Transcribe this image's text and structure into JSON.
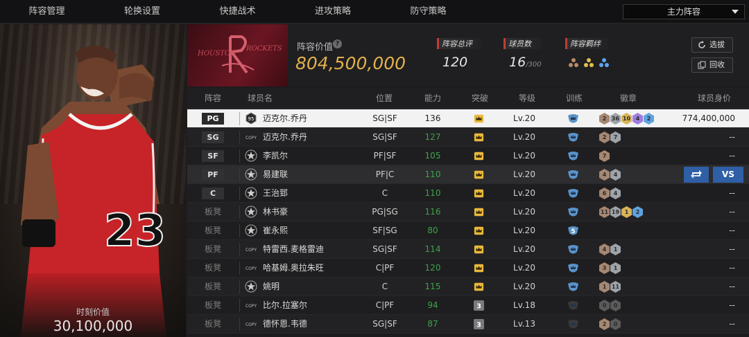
{
  "tabs": [
    {
      "label": "阵容管理",
      "active": true
    },
    {
      "label": "轮换设置",
      "active": false
    },
    {
      "label": "快捷战术",
      "active": false
    },
    {
      "label": "进攻策略",
      "active": false
    },
    {
      "label": "防守策略",
      "active": false
    }
  ],
  "lineup_select": {
    "value": "主力阵容"
  },
  "portrait": {
    "moment_label": "时刻价值",
    "moment_value": "30,100,000",
    "jersey_number": "23"
  },
  "team": {
    "logo_text_left": "HOUSTON",
    "logo_text_right": "ROCKETS",
    "value_label": "阵容价值",
    "value_amount": "804,500,000",
    "rating_label": "阵容总评",
    "rating_value": "120",
    "count_label": "球员数",
    "count_value": "16",
    "count_max": "/300",
    "bond_label": "阵容羁绊",
    "pick_label": "选拔",
    "recall_label": "回收"
  },
  "columns": {
    "lineup": "阵容",
    "name": "球员名",
    "position": "位置",
    "ability": "能力",
    "breakthrough": "突破",
    "level": "等级",
    "training": "训练",
    "badges": "徽章",
    "value": "球员身价"
  },
  "actions": {
    "swap": "",
    "vs": "VS"
  },
  "colors": {
    "accent": "#e5a84a",
    "ability_green": "#3fa24a",
    "action_blue": "#2f5fa6",
    "team_red": "#6a1622"
  },
  "players": [
    {
      "lineup": "PG",
      "starter": true,
      "card": "95",
      "name": "迈克尔.乔丹",
      "position": "SG|SF",
      "ability": "136",
      "bt": "crown",
      "level": "Lv.20",
      "training": "crown",
      "badges": [
        {
          "t": "2",
          "c": "#a58773"
        },
        {
          "t": "36",
          "c": "#9fa3a8"
        },
        {
          "t": "10",
          "c": "#d9b356"
        },
        {
          "t": "4",
          "c": "#9f7be0"
        },
        {
          "t": "2",
          "c": "#5fa3e0"
        }
      ],
      "value": "774,400,000"
    },
    {
      "lineup": "SG",
      "starter": true,
      "card": "COPY",
      "name": "迈克尔.乔丹",
      "position": "SG|SF",
      "ability": "127",
      "bt": "crown",
      "level": "Lv.20",
      "training": "crown",
      "badges": [
        {
          "t": "2",
          "c": "#a58773"
        },
        {
          "t": "7",
          "c": "#9fa3a8"
        }
      ],
      "value": "--"
    },
    {
      "lineup": "SF",
      "starter": true,
      "card": "star",
      "name": "李凯尔",
      "position": "PF|SF",
      "ability": "105",
      "bt": "crown",
      "level": "Lv.20",
      "training": "crown",
      "badges": [
        {
          "t": "7",
          "c": "#a58773"
        }
      ],
      "value": "--"
    },
    {
      "lineup": "PF",
      "starter": true,
      "card": "star",
      "name": "易建联",
      "position": "PF|C",
      "ability": "110",
      "bt": "crown",
      "level": "Lv.20",
      "training": "crown",
      "badges": [
        {
          "t": "4",
          "c": "#a58773"
        },
        {
          "t": "4",
          "c": "#9fa3a8"
        }
      ],
      "value": ""
    },
    {
      "lineup": "C",
      "starter": true,
      "card": "star",
      "name": "王治郅",
      "position": "C",
      "ability": "110",
      "bt": "crown",
      "level": "Lv.20",
      "training": "crown",
      "badges": [
        {
          "t": "6",
          "c": "#a58773"
        },
        {
          "t": "4",
          "c": "#9fa3a8"
        }
      ],
      "value": "--"
    },
    {
      "lineup": "板凳",
      "starter": false,
      "card": "star",
      "name": "林书豪",
      "position": "PG|SG",
      "ability": "116",
      "bt": "crown",
      "level": "Lv.20",
      "training": "crown",
      "badges": [
        {
          "t": "11",
          "c": "#a58773"
        },
        {
          "t": "19",
          "c": "#9fa3a8"
        },
        {
          "t": "1",
          "c": "#d9b356"
        },
        {
          "t": "2",
          "c": "#5fa3e0"
        }
      ],
      "value": "--"
    },
    {
      "lineup": "板凳",
      "starter": false,
      "card": "star",
      "name": "崔永熙",
      "position": "SF|SG",
      "ability": "80",
      "bt": "crown",
      "level": "Lv.20",
      "training": "5",
      "badges": [],
      "value": "--"
    },
    {
      "lineup": "板凳",
      "starter": false,
      "card": "COPY",
      "name": "特雷西.麦格雷迪",
      "position": "SG|SF",
      "ability": "114",
      "bt": "crown",
      "level": "Lv.20",
      "training": "crown",
      "badges": [
        {
          "t": "4",
          "c": "#a58773"
        },
        {
          "t": "1",
          "c": "#9fa3a8"
        }
      ],
      "value": "--"
    },
    {
      "lineup": "板凳",
      "starter": false,
      "card": "COPY",
      "name": "哈基姆.奥拉朱旺",
      "position": "C|PF",
      "ability": "120",
      "bt": "crown",
      "level": "Lv.20",
      "training": "crown",
      "badges": [
        {
          "t": "3",
          "c": "#a58773"
        },
        {
          "t": "1",
          "c": "#9fa3a8"
        }
      ],
      "value": "--"
    },
    {
      "lineup": "板凳",
      "starter": false,
      "card": "star",
      "name": "姚明",
      "position": "C",
      "ability": "115",
      "bt": "crown",
      "level": "Lv.20",
      "training": "crown",
      "badges": [
        {
          "t": "1",
          "c": "#a58773"
        },
        {
          "t": "11",
          "c": "#9fa3a8"
        }
      ],
      "value": "--"
    },
    {
      "lineup": "板凳",
      "starter": false,
      "card": "COPY",
      "name": "比尔.拉塞尔",
      "position": "C|PF",
      "ability": "94",
      "bt": "3",
      "level": "Lv.18",
      "training": "none",
      "badges": [
        {
          "t": "0",
          "c": "#5a5a5a"
        },
        {
          "t": "0",
          "c": "#5a5a5a"
        }
      ],
      "value": "--"
    },
    {
      "lineup": "板凳",
      "starter": false,
      "card": "COPY",
      "name": "德怀恩.韦德",
      "position": "SG|SF",
      "ability": "87",
      "bt": "3",
      "level": "Lv.13",
      "training": "none",
      "badges": [
        {
          "t": "2",
          "c": "#a58773"
        },
        {
          "t": "0",
          "c": "#5a5a5a"
        }
      ],
      "value": "--"
    }
  ]
}
